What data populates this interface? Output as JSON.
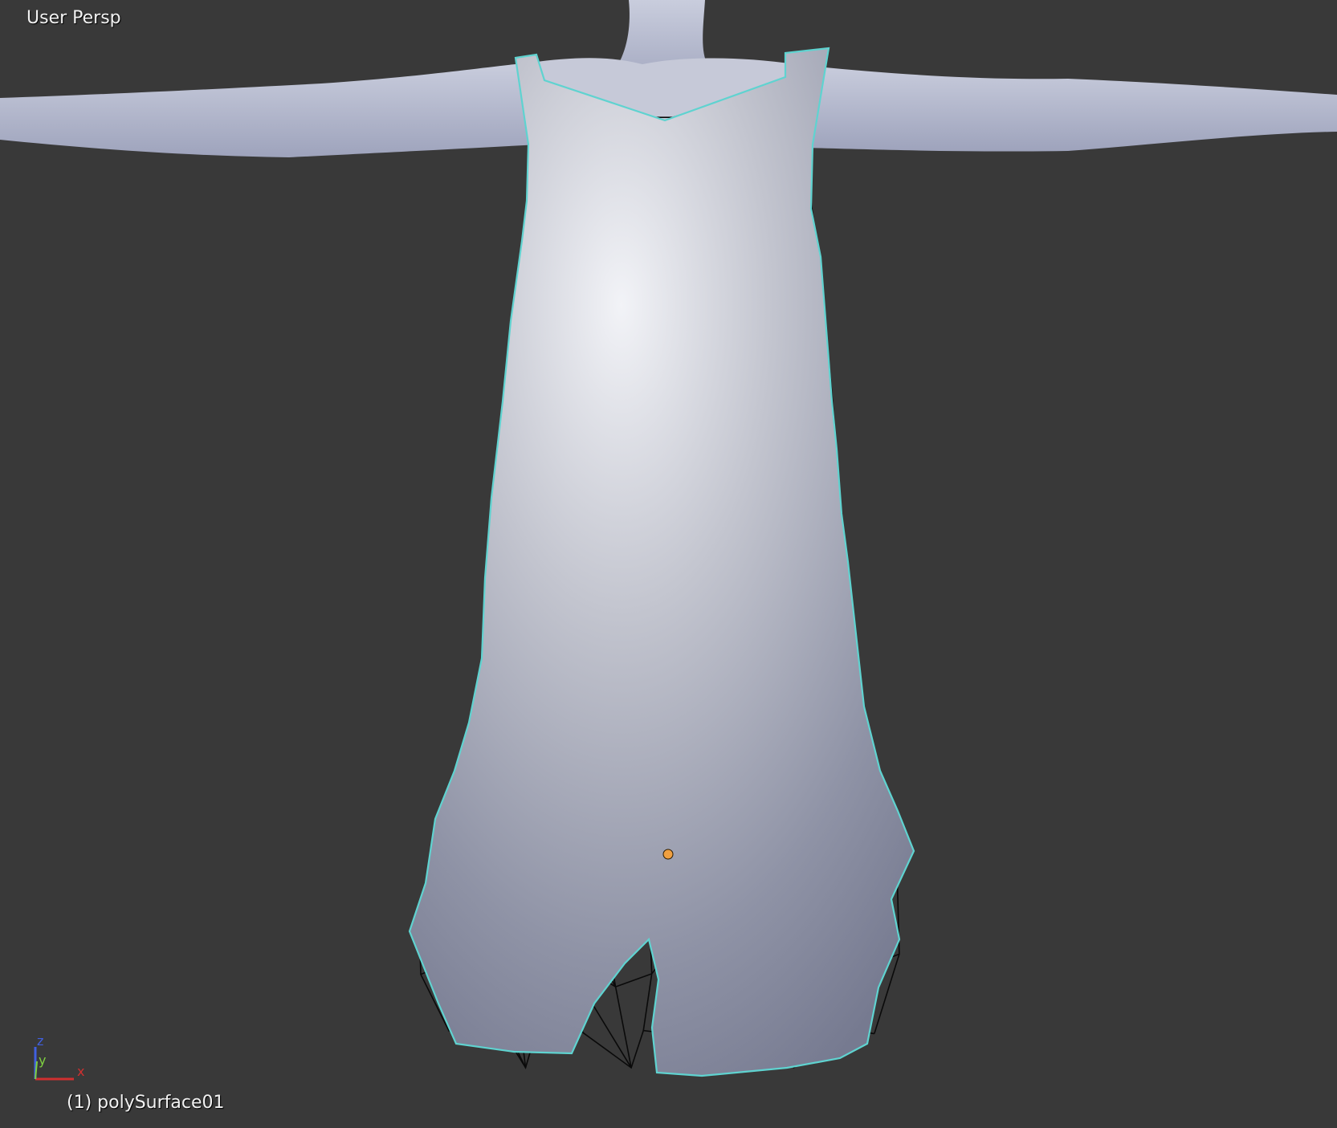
{
  "viewport": {
    "view_label": "User Persp",
    "object_label": "(1) polySurface01",
    "background_color": "#393939",
    "mesh_wire_color": "#0a0a0a",
    "selection_outline_color": "#5fd3d0",
    "body_color": "#b9bdd0",
    "active_vertex_color": "#f0a040"
  },
  "axis_gizmo": {
    "x_label": "x",
    "y_label": "y",
    "z_label": "z",
    "x_color": "#d03030",
    "y_color": "#7fd040",
    "z_color": "#4060e0"
  }
}
